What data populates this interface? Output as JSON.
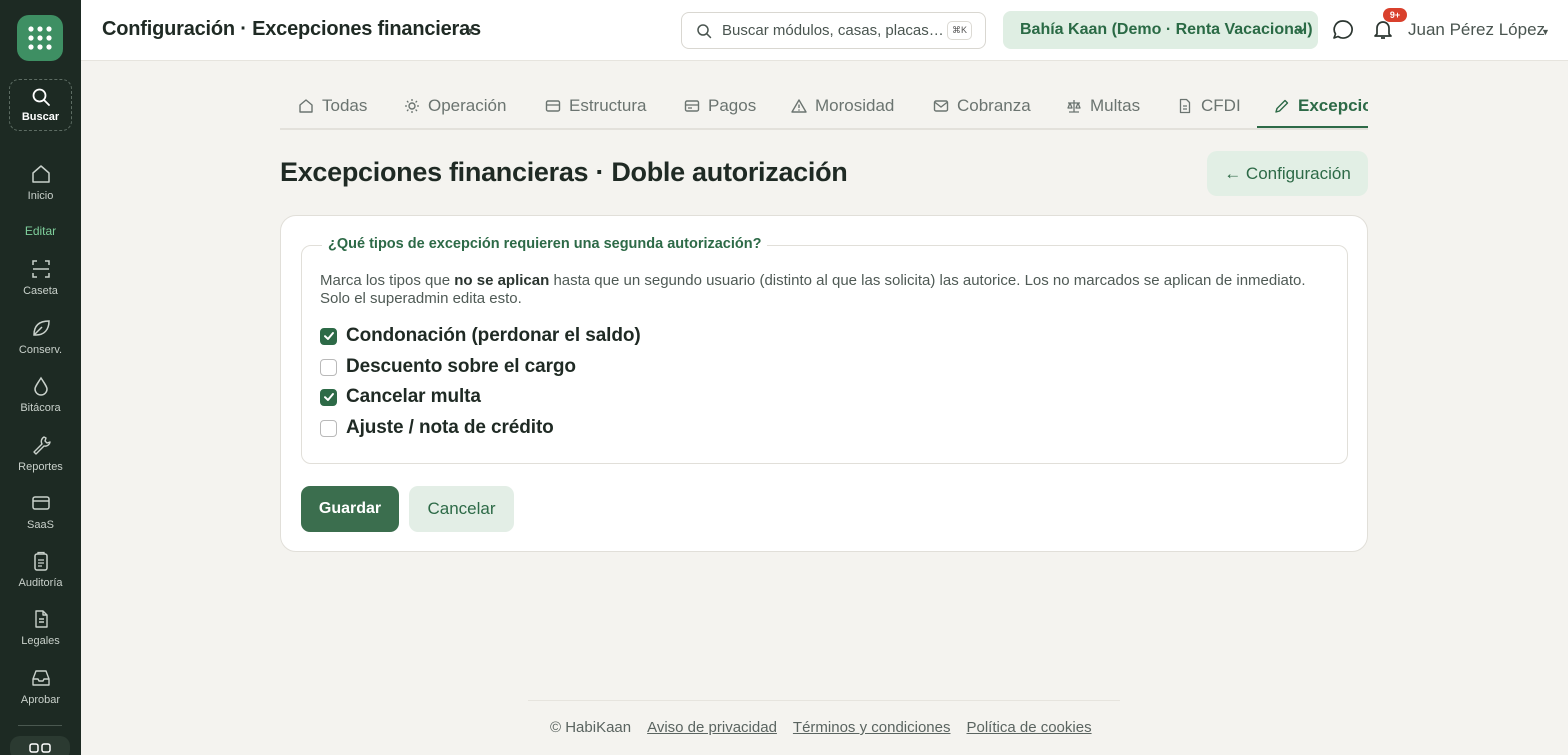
{
  "sidebar": {
    "search_label": "Buscar",
    "section_label": "Editar",
    "items": [
      {
        "label": "Inicio",
        "icon": "home-icon"
      },
      {
        "label": "Caseta",
        "icon": "scan-icon"
      },
      {
        "label": "Conserv.",
        "icon": "leaf-icon"
      },
      {
        "label": "Bitácora",
        "icon": "drop-icon"
      },
      {
        "label": "Reportes",
        "icon": "wrench-icon"
      },
      {
        "label": "SaaS",
        "icon": "card-icon"
      },
      {
        "label": "Auditoría",
        "icon": "clipboard-icon"
      },
      {
        "label": "Legales",
        "icon": "document-icon"
      },
      {
        "label": "Aprobar",
        "icon": "inbox-icon"
      }
    ]
  },
  "header": {
    "title": "Configuración · Excepciones financieras",
    "search_placeholder": "Buscar módulos, casas, placas…",
    "search_shortcut": "⌘K",
    "tenant": "Bahía Kaan (Demo · Renta Vacacional)",
    "notifications_badge": "9+",
    "user_name": "Juan Pérez López"
  },
  "tabs": [
    {
      "label": "Todas",
      "icon": "home-icon"
    },
    {
      "label": "Operación",
      "icon": "sun-icon"
    },
    {
      "label": "Estructura",
      "icon": "table-icon"
    },
    {
      "label": "Pagos",
      "icon": "card-icon"
    },
    {
      "label": "Morosidad",
      "icon": "warning-icon"
    },
    {
      "label": "Cobranza",
      "icon": "mail-icon"
    },
    {
      "label": "Multas",
      "icon": "scale-icon"
    },
    {
      "label": "CFDI",
      "icon": "document-icon"
    },
    {
      "label": "Excepciones",
      "icon": "pencil-icon",
      "active": true
    }
  ],
  "main": {
    "title": "Excepciones financieras · Doble autorización",
    "back_button": "← Configuración"
  },
  "form": {
    "legend": "¿Qué tipos de excepción requieren una segunda autorización?",
    "desc_pre": "Marca los tipos que ",
    "desc_bold": "no se aplican",
    "desc_post": " hasta que un segundo usuario (distinto al que las solicita) las autorice. Los no marcados se aplican de inmediato. Solo el superadmin edita esto.",
    "options": [
      {
        "label": "Condonación (perdonar el saldo)",
        "checked": true
      },
      {
        "label": "Descuento sobre el cargo",
        "checked": false
      },
      {
        "label": "Cancelar multa",
        "checked": true
      },
      {
        "label": "Ajuste / nota de crédito",
        "checked": false
      }
    ],
    "save_label": "Guardar",
    "cancel_label": "Cancelar"
  },
  "footer": {
    "copyright": "© HabiKaan",
    "links": [
      "Aviso de privacidad",
      "Términos y condiciones",
      "Política de cookies"
    ]
  },
  "colors": {
    "sidebar_bg": "#1d2a23",
    "accent": "#2d6a47",
    "page_bg": "#f4f3ef",
    "badge": "#d9402c"
  }
}
